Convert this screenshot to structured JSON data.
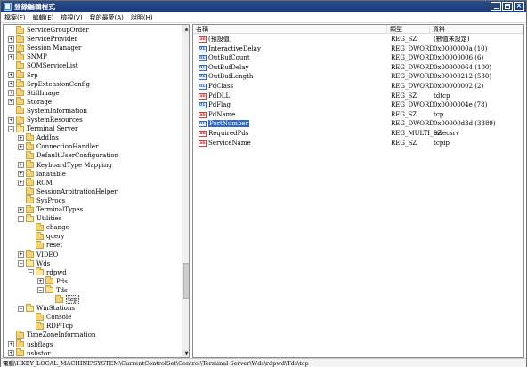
{
  "window": {
    "title": "登錄編輯程式"
  },
  "menu": [
    "檔案(F)",
    "編輯(E)",
    "檢視(V)",
    "我的最愛(A)",
    "說明(H)"
  ],
  "tree": [
    {
      "label": "ServiceGroupOrder",
      "level": 4,
      "expander": "none"
    },
    {
      "label": "ServiceProvider",
      "level": 4,
      "expander": "plus"
    },
    {
      "label": "Session Manager",
      "level": 4,
      "expander": "plus"
    },
    {
      "label": "SNMP",
      "level": 4,
      "expander": "plus"
    },
    {
      "label": "SQMServiceList",
      "level": 4,
      "expander": "none"
    },
    {
      "label": "Srp",
      "level": 4,
      "expander": "plus"
    },
    {
      "label": "SrpExtensionConfig",
      "level": 4,
      "expander": "plus"
    },
    {
      "label": "StillImage",
      "level": 4,
      "expander": "plus"
    },
    {
      "label": "Storage",
      "level": 4,
      "expander": "plus"
    },
    {
      "label": "SystemInformation",
      "level": 4,
      "expander": "none"
    },
    {
      "label": "SystemResources",
      "level": 4,
      "expander": "plus"
    },
    {
      "label": "Terminal Server",
      "level": 4,
      "expander": "minus",
      "open": true
    },
    {
      "label": "AddIns",
      "level": 5,
      "expander": "plus"
    },
    {
      "label": "ConnectionHandler",
      "level": 5,
      "expander": "plus"
    },
    {
      "label": "DefaultUserConfiguration",
      "level": 5,
      "expander": "none"
    },
    {
      "label": "KeyboardType Mapping",
      "level": 5,
      "expander": "plus"
    },
    {
      "label": "lanatable",
      "level": 5,
      "expander": "plus"
    },
    {
      "label": "RCM",
      "level": 5,
      "expander": "plus"
    },
    {
      "label": "SessionArbitrationHelper",
      "level": 5,
      "expander": "none"
    },
    {
      "label": "SysProcs",
      "level": 5,
      "expander": "none"
    },
    {
      "label": "TerminalTypes",
      "level": 5,
      "expander": "plus"
    },
    {
      "label": "Utilities",
      "level": 5,
      "expander": "minus",
      "open": true
    },
    {
      "label": "change",
      "level": 6,
      "expander": "none"
    },
    {
      "label": "query",
      "level": 6,
      "expander": "none"
    },
    {
      "label": "reset",
      "level": 6,
      "expander": "none"
    },
    {
      "label": "VIDEO",
      "level": 5,
      "expander": "plus"
    },
    {
      "label": "Wds",
      "level": 5,
      "expander": "minus",
      "open": true
    },
    {
      "label": "rdpwd",
      "level": 6,
      "expander": "minus",
      "open": true
    },
    {
      "label": "Pds",
      "level": 7,
      "expander": "plus"
    },
    {
      "label": "Tds",
      "level": 7,
      "expander": "minus",
      "open": true
    },
    {
      "label": "tcp",
      "level": 8,
      "expander": "none",
      "selected": true
    },
    {
      "label": "WinStations",
      "level": 5,
      "expander": "minus",
      "open": true
    },
    {
      "label": "Console",
      "level": 6,
      "expander": "none"
    },
    {
      "label": "RDP-Tcp",
      "level": 6,
      "expander": "none"
    },
    {
      "label": "TimeZoneInformation",
      "level": 4,
      "expander": "none"
    },
    {
      "label": "usbflags",
      "level": 4,
      "expander": "plus"
    },
    {
      "label": "usbstor",
      "level": 4,
      "expander": "plus"
    }
  ],
  "list": {
    "columns": [
      "名稱",
      "類型",
      "資料"
    ],
    "rows": [
      {
        "icon": "string",
        "name": "(預設值)",
        "type": "REG_SZ",
        "data": "(數值未設定)"
      },
      {
        "icon": "binary",
        "name": "InteractiveDelay",
        "type": "REG_DWORD",
        "data": "0x0000000a (10)"
      },
      {
        "icon": "binary",
        "name": "OutBufCount",
        "type": "REG_DWORD",
        "data": "0x00000006 (6)"
      },
      {
        "icon": "binary",
        "name": "OutBufDelay",
        "type": "REG_DWORD",
        "data": "0x00000064 (100)"
      },
      {
        "icon": "binary",
        "name": "OutBufLength",
        "type": "REG_DWORD",
        "data": "0x00000212 (530)"
      },
      {
        "icon": "binary",
        "name": "PdClass",
        "type": "REG_DWORD",
        "data": "0x00000002 (2)"
      },
      {
        "icon": "string",
        "name": "PdDLL",
        "type": "REG_SZ",
        "data": "tdtcp"
      },
      {
        "icon": "binary",
        "name": "PdFlag",
        "type": "REG_DWORD",
        "data": "0x0000004e (78)"
      },
      {
        "icon": "string",
        "name": "PdName",
        "type": "REG_SZ",
        "data": "tcp"
      },
      {
        "icon": "binary",
        "name": "PortNumber",
        "type": "REG_DWORD",
        "data": "0x00000d3d (3389)",
        "selected": true
      },
      {
        "icon": "string",
        "name": "RequiredPds",
        "type": "REG_MULTI_SZ",
        "data": "tssecsrv"
      },
      {
        "icon": "string",
        "name": "ServiceName",
        "type": "REG_SZ",
        "data": "tcpip"
      }
    ]
  },
  "status": {
    "path": "電腦\\HKEY_LOCAL_MACHINE\\SYSTEM\\CurrentControlSet\\Control\\Terminal Server\\Wds\\rdpwd\\Tds\\tcp"
  },
  "colors": {
    "titlebar": "#1a3a78",
    "selection": "#316ac5"
  }
}
